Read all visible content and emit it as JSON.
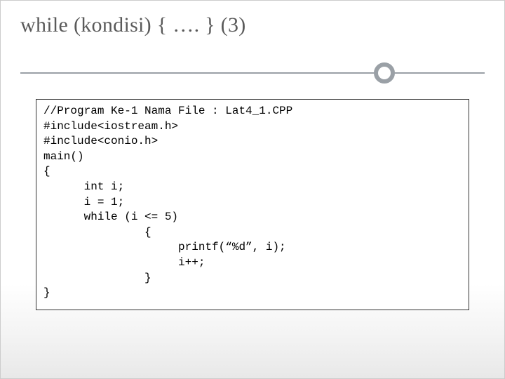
{
  "header": {
    "title": "while (kondisi) { …. } (3)"
  },
  "code": {
    "text": "//Program Ke-1 Nama File : Lat4_1.CPP\n#include<iostream.h>\n#include<conio.h>\nmain()\n{\n      int i;\n      i = 1;\n      while (i <= 5)\n               {\n                    printf(“%d”, i);\n                    i++;\n               }\n}"
  }
}
